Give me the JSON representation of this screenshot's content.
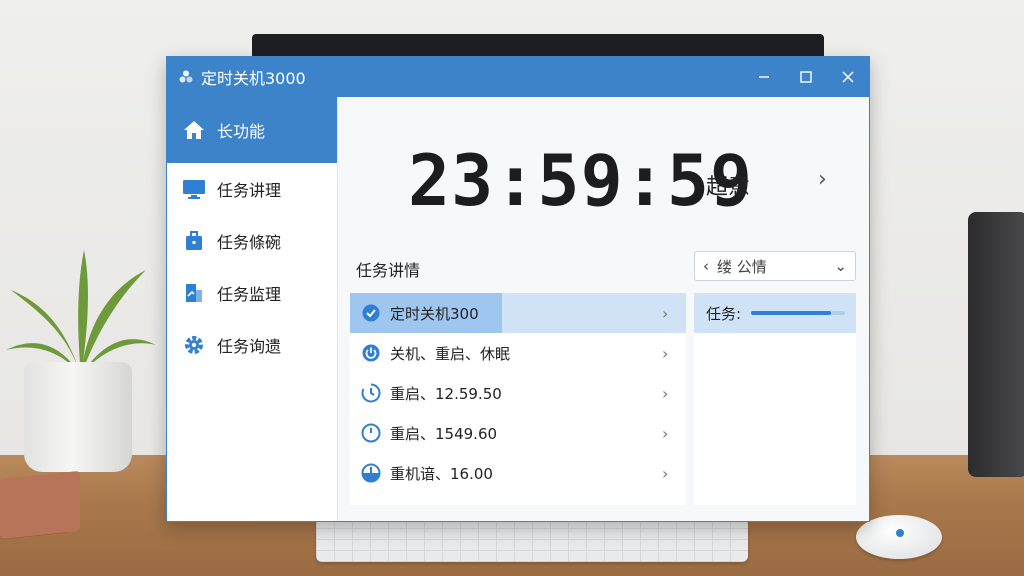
{
  "window": {
    "title": "定时关机3000",
    "controls": {
      "minimize": "−",
      "maximize": "□",
      "close": "✕"
    }
  },
  "sidebar": {
    "items": [
      {
        "label": "长功能",
        "icon": "home-icon",
        "active": true
      },
      {
        "label": "任务讲理",
        "icon": "monitor-icon",
        "active": false
      },
      {
        "label": "任务條碗",
        "icon": "briefcase-icon",
        "active": false
      },
      {
        "label": "任务监理",
        "icon": "document-icon",
        "active": false
      },
      {
        "label": "任务询遗",
        "icon": "gear-icon",
        "active": false
      }
    ]
  },
  "clock": {
    "time": "23:59:59",
    "unit": "超意",
    "chevron": "›"
  },
  "tasks": {
    "title": "任务讲情",
    "filter": {
      "prefix": "‹",
      "label": "缕 公情",
      "caret": "⌄"
    },
    "rows": [
      {
        "icon": "check-circle-icon",
        "label": "定时关机300",
        "selected": true
      },
      {
        "icon": "power-icon",
        "label": "关机、重启、休眠",
        "selected": false
      },
      {
        "icon": "timer-icon",
        "label": "重启、12.59.50",
        "selected": false
      },
      {
        "icon": "clock-icon",
        "label": "重启、1549.60",
        "selected": false
      },
      {
        "icon": "half-clock-icon",
        "label": "重机谙、16.00",
        "selected": false
      }
    ],
    "row_chevron": "›"
  },
  "detail": {
    "label": "任务:",
    "progress": 0.85
  },
  "colors": {
    "accent": "#3c83c9",
    "selected_row": "#cfe2f6",
    "selected_highlight": "#9ec6ee",
    "progress": "#2f7fd3"
  }
}
